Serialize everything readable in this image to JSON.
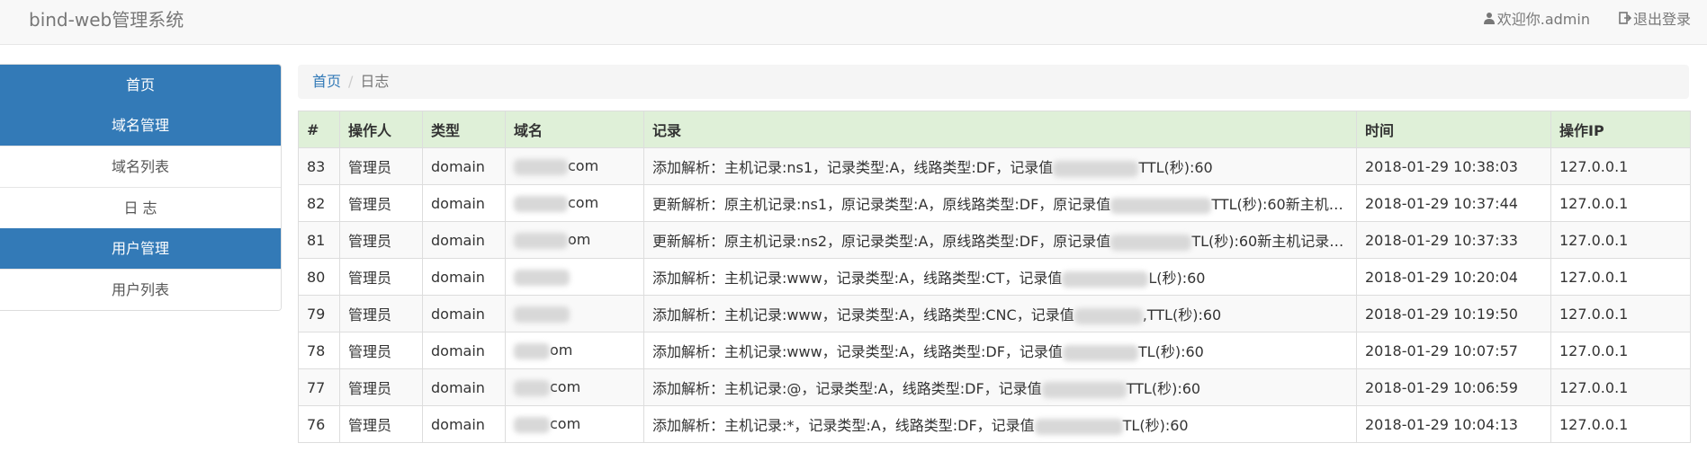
{
  "header": {
    "brand": "bind-web管理系统",
    "welcome": "欢迎你.admin",
    "logout": "退出登录"
  },
  "sidebar": {
    "items": [
      {
        "label": "首页",
        "type": "head"
      },
      {
        "label": "域名管理",
        "type": "head"
      },
      {
        "label": "域名列表",
        "type": "link"
      },
      {
        "label": "日 志",
        "type": "link"
      },
      {
        "label": "用户管理",
        "type": "head"
      },
      {
        "label": "用户列表",
        "type": "link"
      }
    ]
  },
  "breadcrumb": {
    "home": "首页",
    "current": "日志"
  },
  "table": {
    "columns": [
      "#",
      "操作人",
      "类型",
      "域名",
      "记录",
      "时间",
      "操作IP"
    ],
    "rows": [
      {
        "id": "83",
        "operator": "管理员",
        "type": "domain",
        "domain": "com",
        "record_pre": "添加解析：主机记录:ns1，记录类型:A，线路类型:DF，记录值",
        "record_post": "TTL(秒):60",
        "time": "2018-01-29 10:38:03",
        "ip": "127.0.0.1"
      },
      {
        "id": "82",
        "operator": "管理员",
        "type": "domain",
        "domain": "com",
        "record_pre": "更新解析：原主机记录:ns1，原记录类型:A，原线路类型:DF，原记录值",
        "record_post": "TTL(秒):60新主机…",
        "time": "2018-01-29 10:37:44",
        "ip": "127.0.0.1"
      },
      {
        "id": "81",
        "operator": "管理员",
        "type": "domain",
        "domain": "om",
        "record_pre": "更新解析：原主机记录:ns2，原记录类型:A，原线路类型:DF，原记录值",
        "record_post": "TL(秒):60新主机记录:n…",
        "time": "2018-01-29 10:37:33",
        "ip": "127.0.0.1"
      },
      {
        "id": "80",
        "operator": "管理员",
        "type": "domain",
        "domain": "",
        "record_pre": "添加解析：主机记录:www，记录类型:A，线路类型:CT，记录值",
        "record_post": "L(秒):60",
        "time": "2018-01-29 10:20:04",
        "ip": "127.0.0.1"
      },
      {
        "id": "79",
        "operator": "管理员",
        "type": "domain",
        "domain": "",
        "record_pre": "添加解析：主机记录:www，记录类型:A，线路类型:CNC，记录值",
        "record_post": ",TTL(秒):60",
        "time": "2018-01-29 10:19:50",
        "ip": "127.0.0.1"
      },
      {
        "id": "78",
        "operator": "管理员",
        "type": "domain",
        "domain": "om",
        "record_pre": "添加解析：主机记录:www，记录类型:A，线路类型:DF，记录值",
        "record_post": "TL(秒):60",
        "time": "2018-01-29 10:07:57",
        "ip": "127.0.0.1"
      },
      {
        "id": "77",
        "operator": "管理员",
        "type": "domain",
        "domain": "com",
        "record_pre": "添加解析：主机记录:@，记录类型:A，线路类型:DF，记录值",
        "record_post": "TTL(秒):60",
        "time": "2018-01-29 10:06:59",
        "ip": "127.0.0.1"
      },
      {
        "id": "76",
        "operator": "管理员",
        "type": "domain",
        "domain": "com",
        "record_pre": "添加解析：主机记录:*，记录类型:A，线路类型:DF，记录值",
        "record_post": "TL(秒):60",
        "time": "2018-01-29 10:04:13",
        "ip": "127.0.0.1"
      }
    ]
  }
}
